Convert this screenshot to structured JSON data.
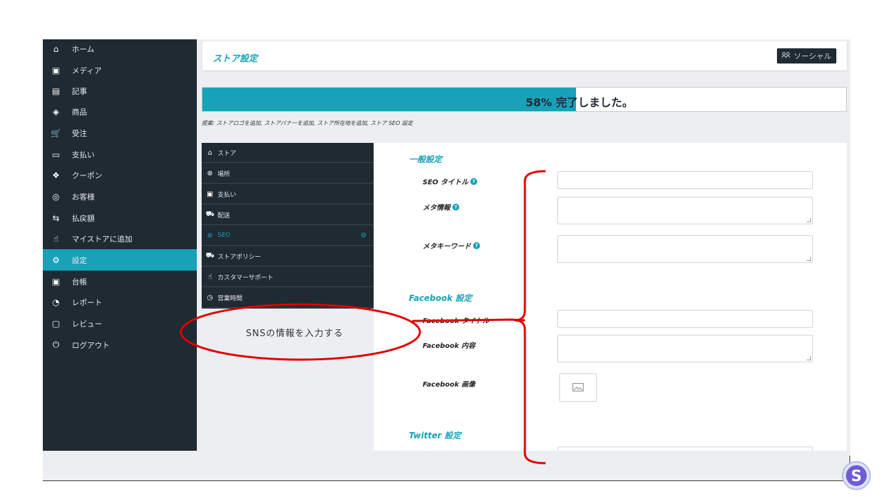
{
  "sidebar": {
    "items": [
      {
        "label": "ホーム",
        "icon": "home-icon",
        "glyph": "⌂"
      },
      {
        "label": "メディア",
        "icon": "media-icon",
        "glyph": "▣"
      },
      {
        "label": "記事",
        "icon": "article-icon",
        "glyph": "▤"
      },
      {
        "label": "商品",
        "icon": "product-icon",
        "glyph": "◈"
      },
      {
        "label": "受注",
        "icon": "cart-icon",
        "glyph": "🛒"
      },
      {
        "label": "支払い",
        "icon": "card-icon",
        "glyph": "▭"
      },
      {
        "label": "クーポン",
        "icon": "gift-icon",
        "glyph": "❖"
      },
      {
        "label": "お客様",
        "icon": "customer-icon",
        "glyph": "◎"
      },
      {
        "label": "払戻額",
        "icon": "refund-icon",
        "glyph": "⇆"
      },
      {
        "label": "マイストアに追加",
        "icon": "hand-icon",
        "glyph": "☝"
      },
      {
        "label": "設定",
        "icon": "settings-icon",
        "glyph": "⚙",
        "active": true
      },
      {
        "label": "台帳",
        "icon": "ledger-icon",
        "glyph": "▣"
      },
      {
        "label": "レポート",
        "icon": "report-icon",
        "glyph": "◔"
      },
      {
        "label": "レビュー",
        "icon": "review-icon",
        "glyph": "▢"
      },
      {
        "label": "ログアウト",
        "icon": "power-icon",
        "glyph": "⏻"
      }
    ]
  },
  "header": {
    "title": "ストア設定",
    "social_button": "ソーシャル"
  },
  "progress": {
    "percent": 58,
    "label": "58% 完了しました。"
  },
  "suggestion": "提案: ストアロゴを追加, ストアバナーを追加, ストア所在地を追加, ストア SEO 設定",
  "tabs": [
    {
      "label": "ストア",
      "icon": "store-icon",
      "glyph": "⌂"
    },
    {
      "label": "場所",
      "icon": "globe-icon",
      "glyph": "⊕"
    },
    {
      "label": "支払い",
      "icon": "money-icon",
      "glyph": "▣"
    },
    {
      "label": "配送",
      "icon": "truck-icon",
      "glyph": "⛟"
    },
    {
      "label": "SEO",
      "icon": "seo-icon",
      "glyph": "⊕",
      "active": true
    },
    {
      "label": "ストアポリシー",
      "icon": "policy-icon",
      "glyph": "⛟"
    },
    {
      "label": "カスタマーサポート",
      "icon": "thumb-icon",
      "glyph": "☝"
    },
    {
      "label": "営業時間",
      "icon": "clock-icon",
      "glyph": "◷"
    }
  ],
  "form": {
    "general_heading": "一般設定",
    "seo_title_label": "SEO タイトル",
    "meta_info_label": "メタ情報",
    "meta_keyword_label": "メタキーワード",
    "facebook_heading": "Facebook 設定",
    "facebook_title_label": "Facebook タイトル",
    "facebook_content_label": "Facebook 内容",
    "facebook_image_label": "Facebook 画像",
    "twitter_heading": "Twitter 設定"
  },
  "annotation": {
    "text": "SNSの情報を入力する",
    "color": "#e00000"
  },
  "colors": {
    "accent": "#17a2b8",
    "sidebar": "#1f2a33"
  }
}
